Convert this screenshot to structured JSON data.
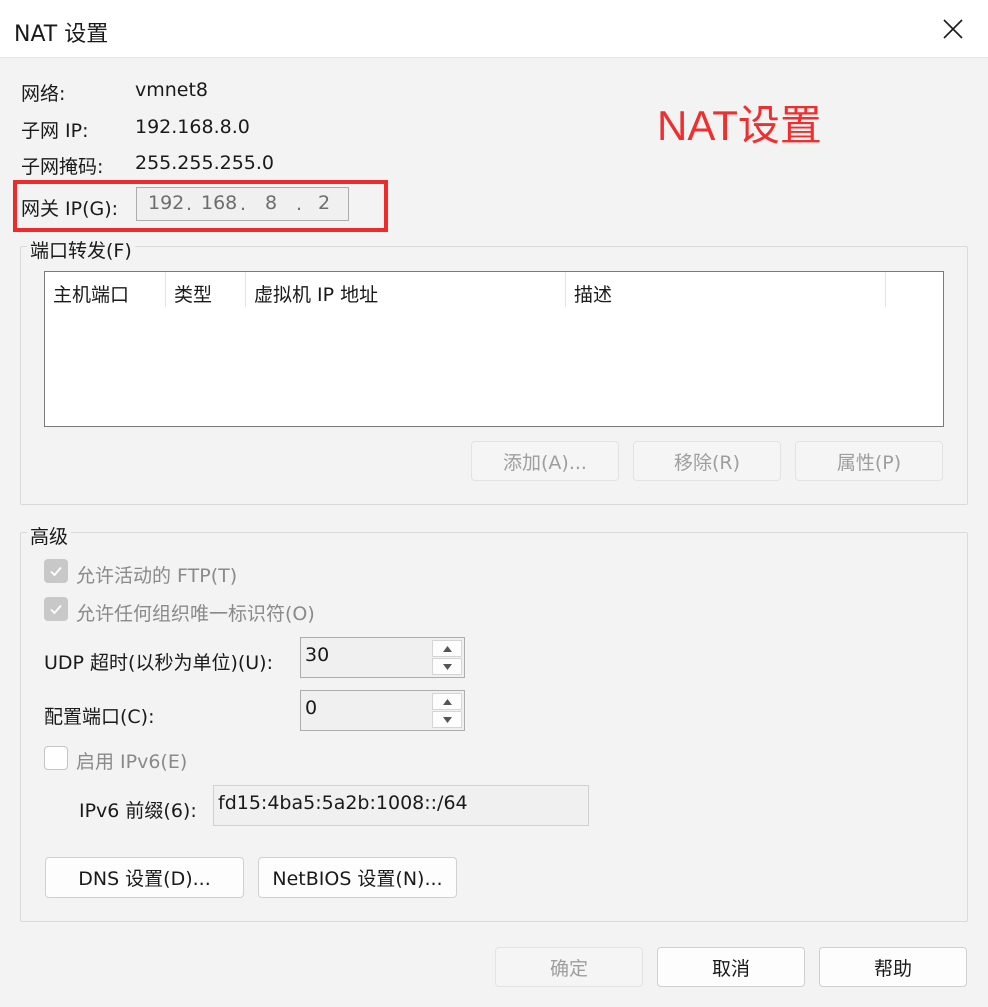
{
  "window": {
    "title": "NAT 设置"
  },
  "info": {
    "network_label": "网络:",
    "network_value": "vmnet8",
    "subnet_ip_label": "子网 IP:",
    "subnet_ip_value": "192.168.8.0",
    "subnet_mask_label": "子网掩码:",
    "subnet_mask_value": "255.255.255.0",
    "gateway_label": "网关 IP(G):",
    "gateway_octets": [
      "192",
      "168",
      "8",
      "2"
    ],
    "gateway_dot": "."
  },
  "annotation": {
    "text": "NAT设置",
    "color": "#ef2f2f"
  },
  "port_forwarding": {
    "title": "端口转发(F)",
    "columns": [
      "主机端口",
      "类型",
      "虚拟机 IP 地址",
      "描述"
    ],
    "rows": [],
    "add_button": "添加(A)...",
    "remove_button": "移除(R)",
    "properties_button": "属性(P)"
  },
  "advanced": {
    "title": "高级",
    "allow_ftp_label": "允许活动的 FTP(T)",
    "allow_ftp_checked": true,
    "allow_oui_label": "允许任何组织唯一标识符(O)",
    "allow_oui_checked": true,
    "udp_timeout_label": "UDP 超时(以秒为单位)(U):",
    "udp_timeout_value": "30",
    "config_port_label": "配置端口(C):",
    "config_port_value": "0",
    "enable_ipv6_label": "启用 IPv6(E)",
    "enable_ipv6_checked": false,
    "ipv6_prefix_label": "IPv6 前缀(6):",
    "ipv6_prefix_value": "fd15:4ba5:5a2b:1008::/64",
    "dns_button": "DNS 设置(D)...",
    "netbios_button": "NetBIOS 设置(N)..."
  },
  "footer": {
    "ok_button": "确定",
    "cancel_button": "取消",
    "help_button": "帮助"
  },
  "icons": {
    "close": "close-icon",
    "checkmark": "checkmark-icon",
    "spin_up": "chevron-up-icon",
    "spin_down": "chevron-down-icon"
  }
}
